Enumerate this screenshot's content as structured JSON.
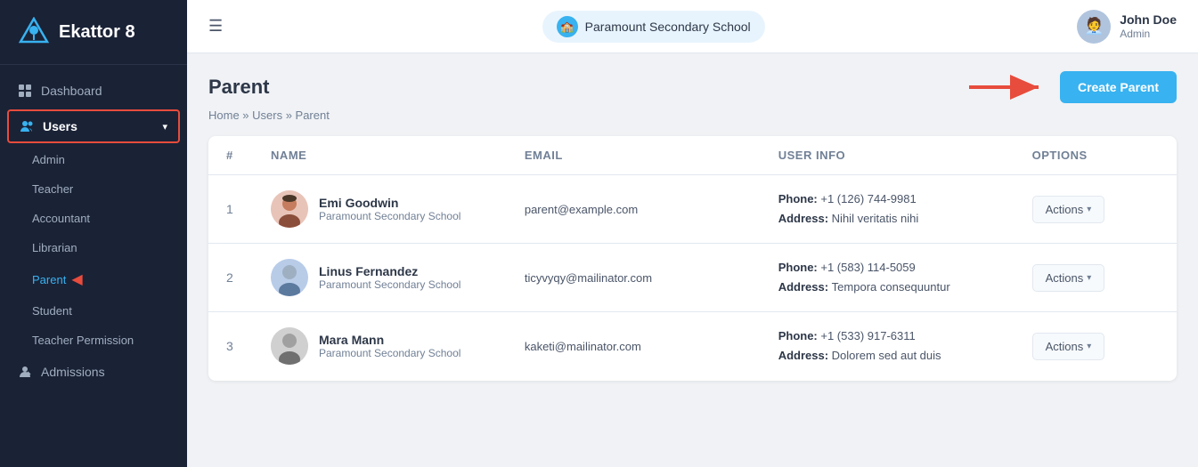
{
  "app": {
    "name": "Ekattor 8"
  },
  "topbar": {
    "school_name": "Paramount Secondary School",
    "user_name": "John Doe",
    "user_role": "Admin"
  },
  "sidebar": {
    "nav_items": [
      {
        "id": "dashboard",
        "label": "Dashboard",
        "icon": "grid"
      },
      {
        "id": "users",
        "label": "Users",
        "icon": "users",
        "active": true
      },
      {
        "id": "admissions",
        "label": "Admissions",
        "icon": "user-plus"
      }
    ],
    "users_sub": [
      {
        "id": "admin",
        "label": "Admin"
      },
      {
        "id": "teacher",
        "label": "Teacher"
      },
      {
        "id": "accountant",
        "label": "Accountant"
      },
      {
        "id": "librarian",
        "label": "Librarian"
      },
      {
        "id": "parent",
        "label": "Parent",
        "active": true
      },
      {
        "id": "student",
        "label": "Student"
      },
      {
        "id": "teacher-permission",
        "label": "Teacher Permission"
      }
    ]
  },
  "page": {
    "title": "Parent",
    "breadcrumb": "Home » Users » Parent",
    "create_button": "Create Parent"
  },
  "table": {
    "columns": [
      "#",
      "Name",
      "Email",
      "User Info",
      "Options"
    ],
    "rows": [
      {
        "num": "1",
        "name": "Emi Goodwin",
        "school": "Paramount Secondary School",
        "email": "parent@example.com",
        "phone": "+1 (126) 744-9981",
        "address": "Nihil veritatis nihi",
        "avatar_type": "female",
        "avatar_emoji": "👩"
      },
      {
        "num": "2",
        "name": "Linus Fernandez",
        "school": "Paramount Secondary School",
        "email": "ticyvyqy@mailinator.com",
        "phone": "+1 (583) 114-5059",
        "address": "Tempora consequuntur",
        "avatar_type": "male1",
        "avatar_emoji": "🧑"
      },
      {
        "num": "3",
        "name": "Mara Mann",
        "school": "Paramount Secondary School",
        "email": "kaketi@mailinator.com",
        "phone": "+1 (533) 917-6311",
        "address": "Dolorem sed aut duis",
        "avatar_type": "male2",
        "avatar_emoji": "👨"
      }
    ],
    "actions_label": "Actions",
    "phone_label": "Phone:",
    "address_label": "Address:"
  }
}
